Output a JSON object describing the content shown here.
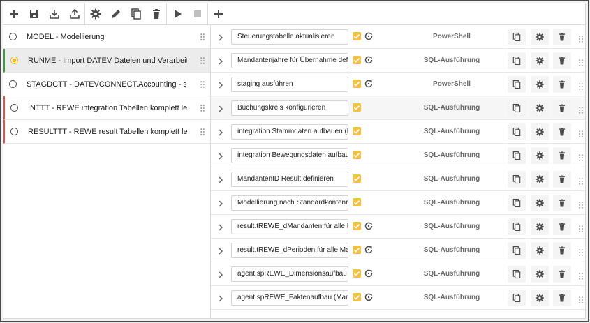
{
  "toolbar": {
    "buttons": [
      {
        "name": "add-icon",
        "icon": "plus"
      },
      {
        "name": "save-icon",
        "icon": "floppy"
      },
      {
        "name": "download-icon",
        "icon": "download"
      },
      {
        "name": "upload-icon",
        "icon": "upload"
      },
      {
        "name": "settings-icon",
        "icon": "gear"
      },
      {
        "name": "edit-icon",
        "icon": "pencil"
      },
      {
        "name": "copy-icon",
        "icon": "copy"
      },
      {
        "name": "delete-icon",
        "icon": "trash"
      },
      {
        "name": "run-icon",
        "icon": "play"
      },
      {
        "name": "stop-icon",
        "icon": "stop"
      },
      {
        "name": "add-step-icon",
        "icon": "plus"
      }
    ]
  },
  "jobs": [
    {
      "label": "MODEL - Modellierung",
      "active": false,
      "mark": ""
    },
    {
      "label": "RUNME - Import DATEV Dateien und Verarbeitung",
      "active": true,
      "mark": "green"
    },
    {
      "label": "STAGDCTT - DATEVCONNECT.Accounting - staging",
      "active": false,
      "mark": ""
    },
    {
      "label": "INTTT - REWE integration Tabellen komplett leeren",
      "active": false,
      "mark": "red"
    },
    {
      "label": "RESULTTT - REWE result Tabellen komplett leeren",
      "active": false,
      "mark": "red"
    }
  ],
  "steps": [
    {
      "name": "Steuerungstabelle aktualisieren",
      "type": "PowerShell",
      "refresh": true
    },
    {
      "name": "Mandantenjahre für Übernahme definieren",
      "type": "SQL-Ausführung",
      "refresh": true
    },
    {
      "name": "staging ausführen",
      "type": "PowerShell",
      "refresh": true
    },
    {
      "name": "Buchungskreis konfigurieren",
      "type": "SQL-Ausführung",
      "refresh": false
    },
    {
      "name": "integration Stammdaten aufbauen (Mandant)",
      "type": "SQL-Ausführung",
      "refresh": false
    },
    {
      "name": "integration Bewegungsdaten aufbauen",
      "type": "SQL-Ausführung",
      "refresh": false
    },
    {
      "name": "MandantenID Result definieren",
      "type": "SQL-Ausführung",
      "refresh": false
    },
    {
      "name": "Modellierung nach Standardkontenrahmen",
      "type": "SQL-Ausführung",
      "refresh": false
    },
    {
      "name": "result.tREWE_dMandanten für alle Mandanten",
      "type": "SQL-Ausführung",
      "refresh": true
    },
    {
      "name": "result.tREWE_dPerioden für alle Mandanten",
      "type": "SQL-Ausführung",
      "refresh": true
    },
    {
      "name": "agent.spREWE_Dimensionsaufbau (Mandant)",
      "type": "SQL-Ausführung",
      "refresh": true
    },
    {
      "name": "agent.spREWE_Faktenaufbau (Mandant)",
      "type": "SQL-Ausführung",
      "refresh": true
    }
  ],
  "colors": {
    "accent": "#f0c24b",
    "active_mark": "#3a9d3a",
    "error_mark": "#d9534f",
    "icon": "#4a4a4a"
  }
}
